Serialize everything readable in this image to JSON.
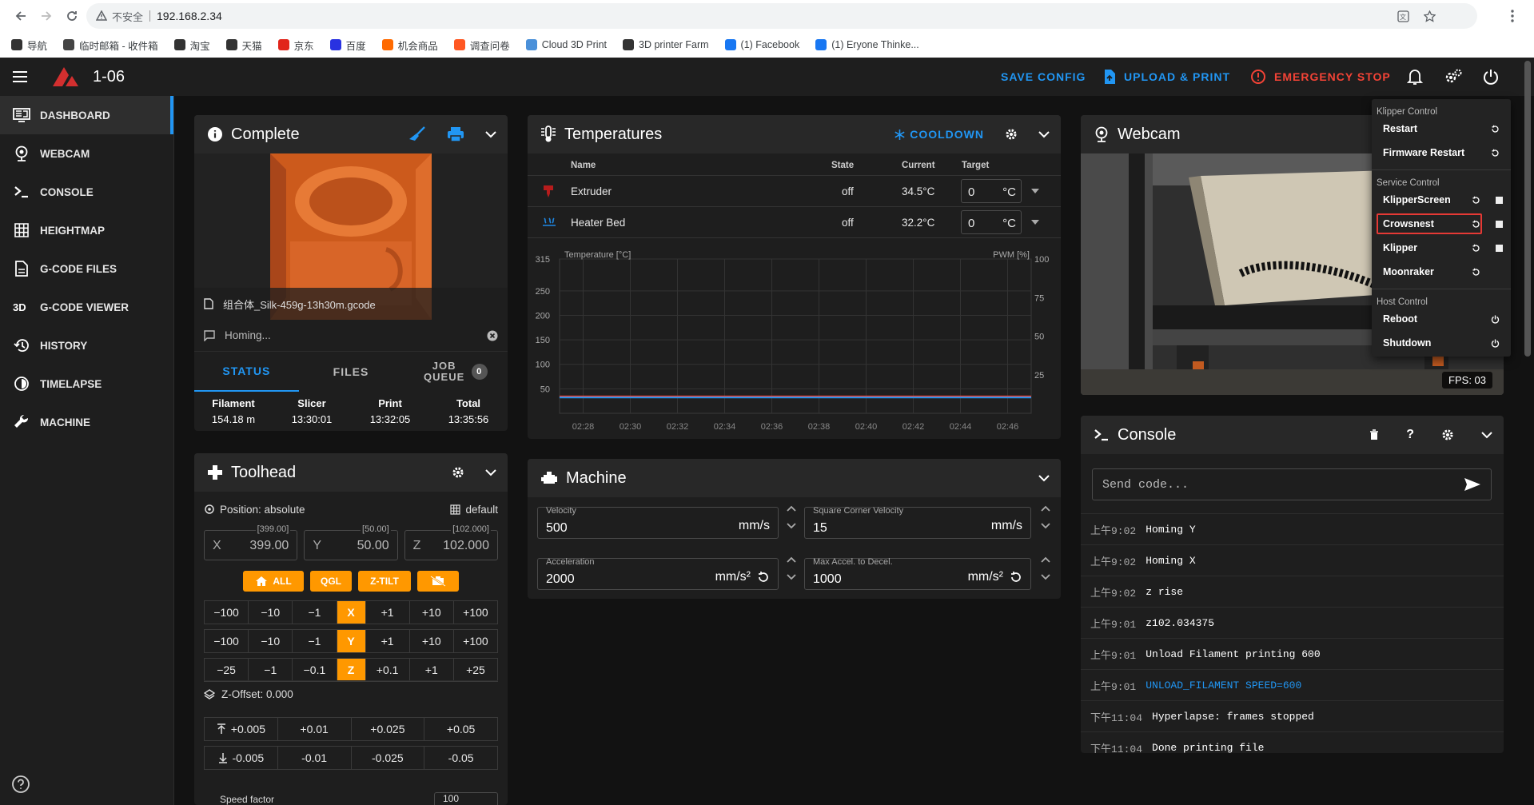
{
  "browser": {
    "insecure_label": "不安全",
    "url": "192.168.2.34",
    "bookmarks": [
      {
        "label": "导航",
        "color": "#333"
      },
      {
        "label": "临时邮箱 - 收件箱",
        "color": "#444"
      },
      {
        "label": "淘宝",
        "color": "#333"
      },
      {
        "label": "天猫",
        "color": "#333"
      },
      {
        "label": "京东",
        "color": "#e1251b"
      },
      {
        "label": "百度",
        "color": "#2932e1"
      },
      {
        "label": "机会商品",
        "color": "#ff6a00"
      },
      {
        "label": "调查问卷",
        "color": "#ff5722"
      },
      {
        "label": "Cloud 3D Print",
        "color": "#4a90d9"
      },
      {
        "label": "3D printer Farm",
        "color": "#333"
      },
      {
        "label": "(1) Facebook",
        "color": "#1877f2"
      },
      {
        "label": "(1) Eryone Thinke...",
        "color": "#1877f2"
      }
    ]
  },
  "appbar": {
    "printer_name": "1-06",
    "save_config": "SAVE CONFIG",
    "upload_print": "UPLOAD & PRINT",
    "emergency_stop": "EMERGENCY STOP"
  },
  "sidebar": {
    "items": [
      {
        "label": "DASHBOARD",
        "icon": "monitor-dashboard-icon",
        "active": true
      },
      {
        "label": "WEBCAM",
        "icon": "webcam-icon"
      },
      {
        "label": "CONSOLE",
        "icon": "console-icon"
      },
      {
        "label": "HEIGHTMAP",
        "icon": "grid-icon"
      },
      {
        "label": "G-CODE FILES",
        "icon": "file-document-icon"
      },
      {
        "label": "G-CODE VIEWER",
        "icon": "3d-icon"
      },
      {
        "label": "HISTORY",
        "icon": "history-icon"
      },
      {
        "label": "TIMELAPSE",
        "icon": "timelapse-icon"
      },
      {
        "label": "MACHINE",
        "icon": "wrench-icon"
      }
    ]
  },
  "status_panel": {
    "title": "Complete",
    "filename": "组合体_Silk-459g-13h30m.gcode",
    "message": "Homing...",
    "tabs": [
      "STATUS",
      "FILES",
      "JOB QUEUE"
    ],
    "job_queue_count": "0",
    "stats": [
      {
        "label": "Filament",
        "value": "154.18 m"
      },
      {
        "label": "Slicer",
        "value": "13:30:01"
      },
      {
        "label": "Print",
        "value": "13:32:05"
      },
      {
        "label": "Total",
        "value": "13:35:56"
      }
    ]
  },
  "toolhead": {
    "title": "Toolhead",
    "position_mode": "Position: absolute",
    "profile": "default",
    "axes": [
      {
        "axis": "X",
        "max": "[399.00]",
        "value": "399.00"
      },
      {
        "axis": "Y",
        "max": "[50.00]",
        "value": "50.00"
      },
      {
        "axis": "Z",
        "max": "[102.000]",
        "value": "102.000"
      }
    ],
    "buttons": [
      "ALL",
      "QGL",
      "Z-TILT"
    ],
    "jog_rows": [
      {
        "axis": "X",
        "left": [
          "−100",
          "−10",
          "−1"
        ],
        "right": [
          "+1",
          "+10",
          "+100"
        ]
      },
      {
        "axis": "Y",
        "left": [
          "−100",
          "−10",
          "−1"
        ],
        "right": [
          "+1",
          "+10",
          "+100"
        ]
      },
      {
        "axis": "Z",
        "left": [
          "−25",
          "−1",
          "−0.1"
        ],
        "right": [
          "+0.1",
          "+1",
          "+25"
        ]
      }
    ],
    "z_offset": "Z-Offset: 0.000",
    "z_up": [
      "+0.005",
      "+0.01",
      "+0.025",
      "+0.05"
    ],
    "z_down": [
      "-0.005",
      "-0.01",
      "-0.025",
      "-0.05"
    ],
    "speed_label": "Speed factor",
    "speed_value": "100"
  },
  "temperatures": {
    "title": "Temperatures",
    "cooldown": "COOLDOWN",
    "columns": [
      "Name",
      "State",
      "Current",
      "Target"
    ],
    "rows": [
      {
        "name": "Extruder",
        "state": "off",
        "current": "34.5°C",
        "target": "0",
        "unit": "°C"
      },
      {
        "name": "Heater Bed",
        "state": "off",
        "current": "32.2°C",
        "target": "0",
        "unit": "°C"
      }
    ]
  },
  "chart_data": {
    "type": "line",
    "ylabel": "Temperature [°C]",
    "y2label": "PWM [%]",
    "ylim": [
      0,
      315
    ],
    "y_ticks": [
      50,
      100,
      150,
      200,
      250,
      315
    ],
    "y2_ticks": [
      25,
      50,
      75,
      100
    ],
    "x": [
      "02:28",
      "02:30",
      "02:32",
      "02:34",
      "02:36",
      "02:38",
      "02:40",
      "02:42",
      "02:44",
      "02:46"
    ],
    "series": [
      {
        "name": "Extruder",
        "color": "#f44336",
        "values": [
          34.5,
          34.5,
          34.5,
          34.5,
          34.5,
          34.5,
          34.5,
          34.5,
          34.5,
          34.5
        ]
      },
      {
        "name": "Heater Bed",
        "color": "#2196f3",
        "values": [
          32.2,
          32.2,
          32.2,
          32.2,
          32.2,
          32.2,
          32.2,
          32.2,
          32.2,
          32.2
        ]
      }
    ],
    "grid": true
  },
  "machine": {
    "title": "Machine",
    "velocity_label": "Velocity",
    "velocity": "500",
    "velocity_unit": "mm/s",
    "scv_label": "Square Corner Velocity",
    "scv": "15",
    "scv_unit": "mm/s",
    "accel_label": "Acceleration",
    "accel": "2000",
    "accel_unit": "mm/s²",
    "decel_label": "Max Accel. to Decel.",
    "decel": "1000",
    "decel_unit": "mm/s²"
  },
  "webcam": {
    "title": "Webcam",
    "fps": "FPS: 03"
  },
  "power_menu": {
    "klipper_header": "Klipper Control",
    "klipper_items": [
      "Restart",
      "Firmware Restart"
    ],
    "service_header": "Service Control",
    "service_items": [
      "KlipperScreen",
      "Crowsnest",
      "Klipper",
      "Moonraker"
    ],
    "host_header": "Host Control",
    "host_items": [
      "Reboot",
      "Shutdown"
    ]
  },
  "console": {
    "title": "Console",
    "placeholder": "Send code...",
    "lines": [
      {
        "time": "上午9:02",
        "text": "Homing Y",
        "cmd": false
      },
      {
        "time": "上午9:02",
        "text": "Homing X",
        "cmd": false
      },
      {
        "time": "上午9:02",
        "text": "z rise",
        "cmd": false
      },
      {
        "time": "上午9:01",
        "text": "z102.034375",
        "cmd": false
      },
      {
        "time": "上午9:01",
        "text": "Unload Filament printing 600",
        "cmd": false
      },
      {
        "time": "上午9:01",
        "text": "UNLOAD_FILAMENT SPEED=600",
        "cmd": true
      },
      {
        "time": "下午11:04",
        "text": "Hyperlapse: frames stopped",
        "cmd": false
      },
      {
        "time": "下午11:04",
        "text": "Done printing file",
        "cmd": false
      }
    ]
  }
}
